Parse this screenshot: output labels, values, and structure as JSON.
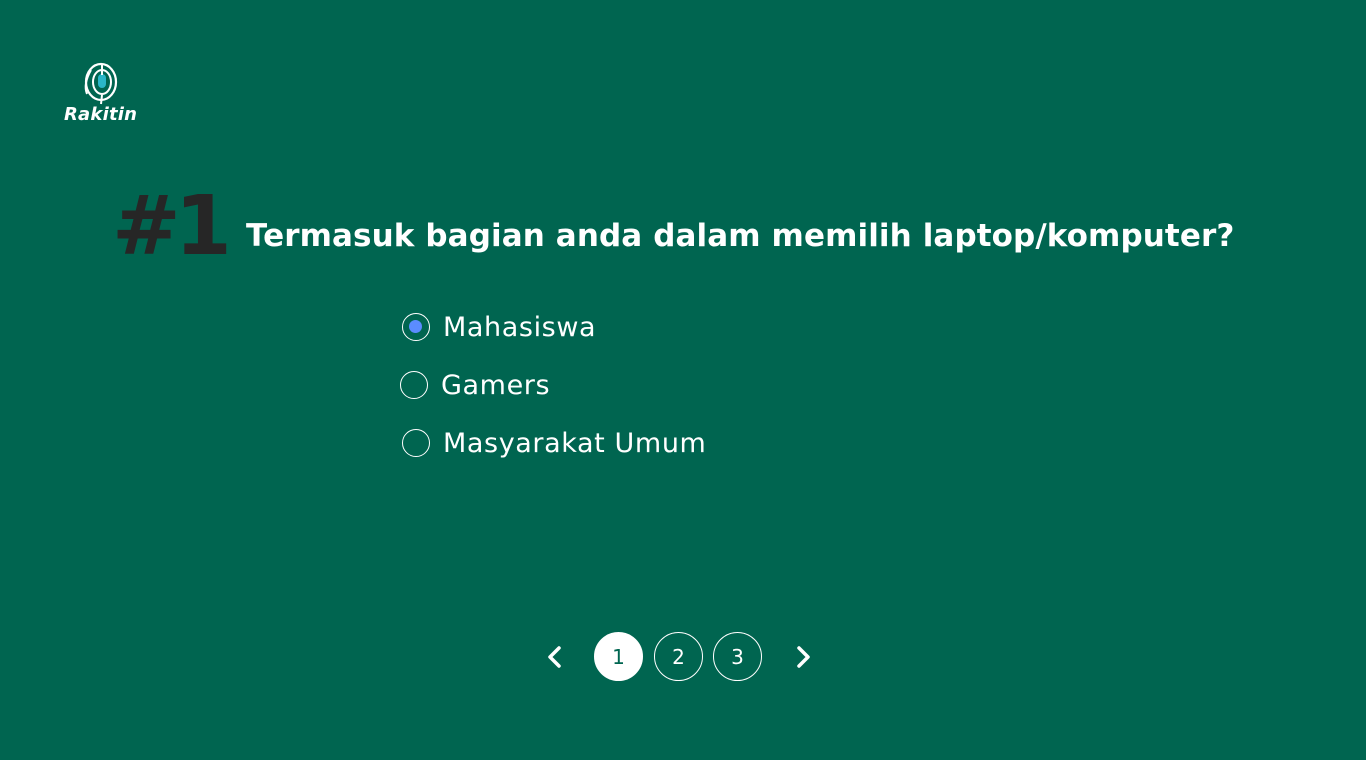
{
  "brand": {
    "name": "Rakitin",
    "icon": "mouse-logo-icon"
  },
  "question": {
    "number": "#1",
    "text": "Termasuk bagian anda dalam memilih laptop/komputer?"
  },
  "options": [
    {
      "label": "Mahasiswa",
      "selected": true
    },
    {
      "label": "Gamers",
      "selected": false
    },
    {
      "label": "Masyarakat Umum",
      "selected": false
    }
  ],
  "pagination": {
    "prev_icon": "chevron-left-icon",
    "next_icon": "chevron-right-icon",
    "pages": [
      "1",
      "2",
      "3"
    ],
    "current": "1"
  },
  "colors": {
    "background": "#006550",
    "number": "#262626",
    "radio_selected": "#5b8cff",
    "text": "#ffffff"
  }
}
